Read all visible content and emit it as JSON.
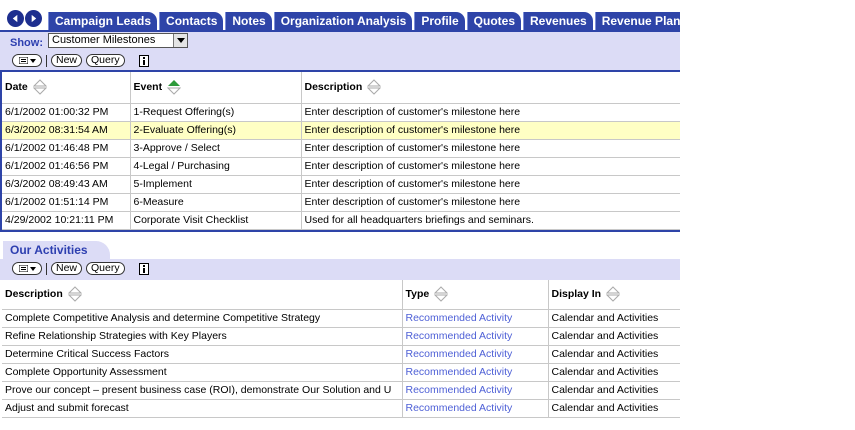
{
  "tabs": [
    {
      "label": "Campaign Leads"
    },
    {
      "label": "Contacts"
    },
    {
      "label": "Notes"
    },
    {
      "label": "Organization Analysis"
    },
    {
      "label": "Profile"
    },
    {
      "label": "Quotes"
    },
    {
      "label": "Revenues"
    },
    {
      "label": "Revenue Plans"
    }
  ],
  "show": {
    "label": "Show:",
    "value": "Customer Milestones"
  },
  "toolbar": {
    "new_label": "New",
    "query_label": "Query"
  },
  "milestones": {
    "columns": [
      "Date",
      "Event",
      "Description"
    ],
    "rows": [
      {
        "date": "6/1/2002 01:00:32 PM",
        "event": "1-Request Offering(s)",
        "description": "Enter description of customer's milestone here"
      },
      {
        "date": "6/3/2002 08:31:54 AM",
        "event": "2-Evaluate Offering(s)",
        "description": "Enter description of customer's milestone here"
      },
      {
        "date": "6/1/2002 01:46:48 PM",
        "event": "3-Approve / Select",
        "description": "Enter description of customer's milestone here"
      },
      {
        "date": "6/1/2002 01:46:56 PM",
        "event": "4-Legal / Purchasing",
        "description": "Enter description of customer's milestone here"
      },
      {
        "date": "6/3/2002 08:49:43 AM",
        "event": "5-Implement",
        "description": "Enter description of customer's milestone here"
      },
      {
        "date": "6/1/2002 01:51:14 PM",
        "event": "6-Measure",
        "description": "Enter description of customer's milestone here"
      },
      {
        "date": "4/29/2002 10:21:11 PM",
        "event": "Corporate Visit Checklist",
        "description": "Used for all headquarters briefings and seminars."
      }
    ]
  },
  "activities": {
    "title": "Our Activities",
    "columns": [
      "Description",
      "Type",
      "Display In"
    ],
    "rows": [
      {
        "description": "Complete Competitive Analysis and determine Competitive Strategy",
        "type": "Recommended Activity",
        "display_in": "Calendar and Activities"
      },
      {
        "description": "Refine Relationship Strategies with Key Players",
        "type": "Recommended Activity",
        "display_in": "Calendar and Activities"
      },
      {
        "description": "Determine Critical Success Factors",
        "type": "Recommended Activity",
        "display_in": "Calendar and Activities"
      },
      {
        "description": "Complete Opportunity Assessment",
        "type": "Recommended Activity",
        "display_in": "Calendar and Activities"
      },
      {
        "description": "Prove our concept – present business case (ROI), demonstrate Our Solution and U",
        "type": "Recommended Activity",
        "display_in": "Calendar and Activities"
      },
      {
        "description": "Adjust and submit forecast",
        "type": "Recommended Activity",
        "display_in": "Calendar and Activities"
      }
    ]
  },
  "colors": {
    "tab": "#2e44a8",
    "panel": "#dcdcf6",
    "selected_row": "#ffffc4",
    "link": "#4d5fd6"
  }
}
